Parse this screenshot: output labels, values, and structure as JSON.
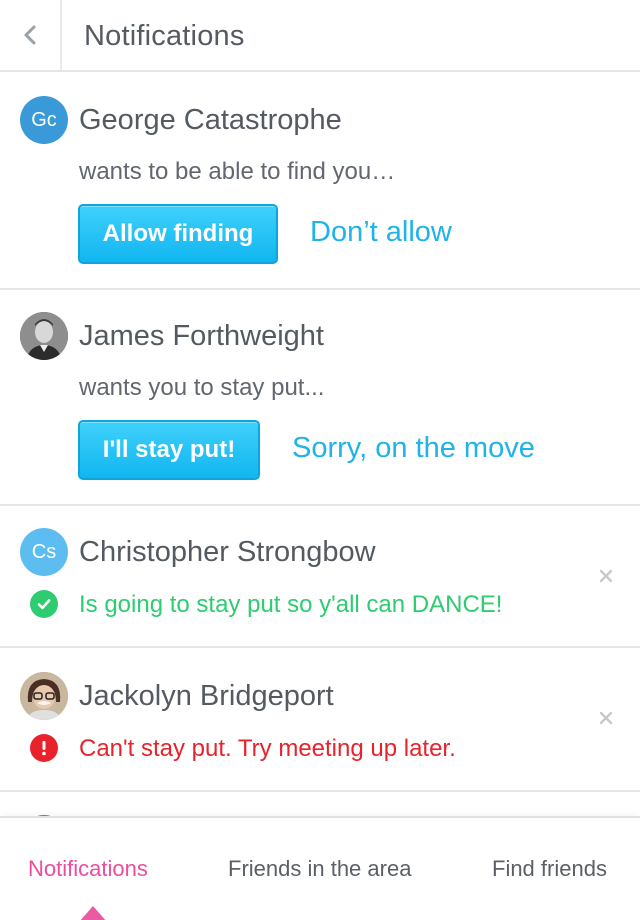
{
  "header": {
    "title": "Notifications"
  },
  "notifications": [
    {
      "avatar_initials": "Gc",
      "name": "George Catastrophe",
      "message": "wants to be able to find you…",
      "primary_action": "Allow finding",
      "secondary_action": "Don’t allow"
    },
    {
      "name": "James Forthweight",
      "message": "wants you to stay put...",
      "primary_action": "I'll stay put!",
      "secondary_action": "Sorry, on the move"
    },
    {
      "avatar_initials": "Cs",
      "name": "Christopher Strongbow",
      "status": "success",
      "status_text": "Is going to stay put so y'all can DANCE!"
    },
    {
      "name": "Jackolyn Bridgeport",
      "status": "error",
      "status_text": "Can't stay put. Try meeting up later."
    }
  ],
  "tabs": [
    {
      "label": "Notifications",
      "active": true
    },
    {
      "label": "Friends in the area",
      "active": false
    },
    {
      "label": "Find friends",
      "active": false
    }
  ],
  "colors": {
    "accent": "#1fb3ea",
    "success": "#2ecc71",
    "error": "#e8232c",
    "active_tab": "#ec4d9c"
  },
  "icons": {
    "back": "chevron-left-icon",
    "close": "close-icon",
    "success": "check-circle-icon",
    "error": "exclamation-circle-icon"
  }
}
